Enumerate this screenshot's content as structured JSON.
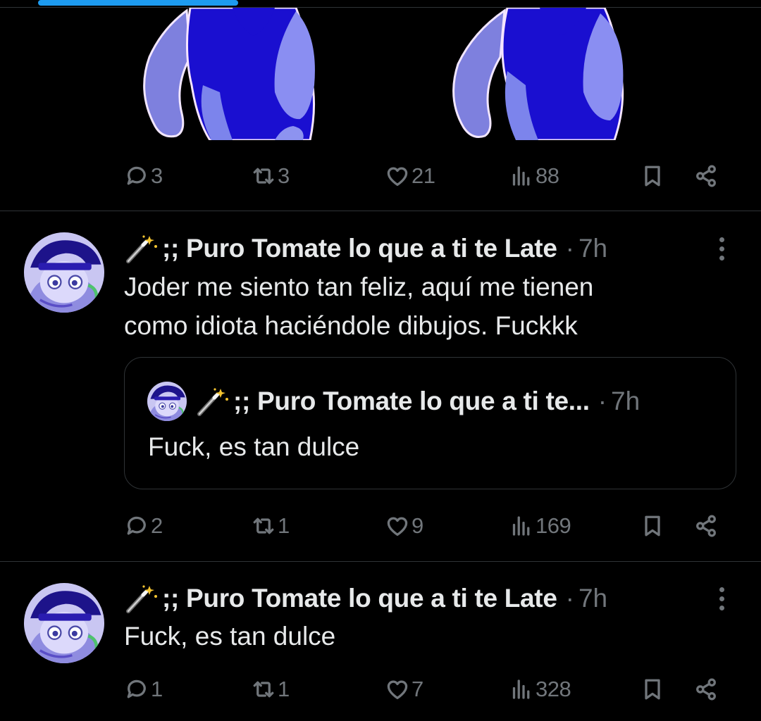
{
  "colors": {
    "background": "#000000",
    "text": "#e7e9ea",
    "muted": "#71767b",
    "divider": "#2f3336",
    "accent": "#1d9bf0"
  },
  "media_post": {
    "actions": {
      "replies": "3",
      "reposts": "3",
      "likes": "21",
      "views": "88"
    }
  },
  "posts": [
    {
      "author_emoji": "🪄",
      "author_name": ";; Puro Tomate lo que a ti te Late",
      "separator": "·",
      "time": "7h",
      "text_line1": "Joder me siento tan feliz, aquí me tienen",
      "text_line2": "como idiota haciéndole dibujos. Fuckkk",
      "quote": {
        "author_name": ";; Puro Tomate lo que a ti te...",
        "separator": "·",
        "time": "7h",
        "text": "Fuck, es tan dulce"
      },
      "actions": {
        "replies": "2",
        "reposts": "1",
        "likes": "9",
        "views": "169"
      }
    },
    {
      "author_emoji": "🪄",
      "author_name": ";; Puro Tomate lo que a ti te Late",
      "separator": "·",
      "time": "7h",
      "text": "Fuck, es tan dulce",
      "actions": {
        "replies": "1",
        "reposts": "1",
        "likes": "7",
        "views": "328"
      }
    }
  ]
}
